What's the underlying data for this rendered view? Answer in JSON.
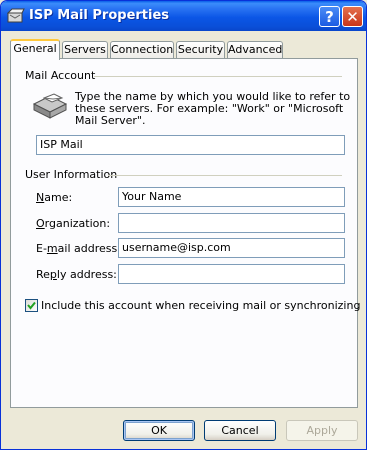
{
  "window": {
    "title": "ISP Mail Properties"
  },
  "titlebar_buttons": {
    "help": "?",
    "close": "✕"
  },
  "tabs": [
    {
      "label": "General",
      "active": true
    },
    {
      "label": "Servers"
    },
    {
      "label": "Connection"
    },
    {
      "label": "Security"
    },
    {
      "label": "Advanced"
    }
  ],
  "mail_account": {
    "group_label": "Mail Account",
    "description": "Type the name by which you would like to refer to these servers.  For example: \"Work\" or \"Microsoft Mail Server\".",
    "account_name": "ISP Mail"
  },
  "user_info": {
    "group_label": "User Information",
    "fields": {
      "name": {
        "label_pre": "",
        "label_accel": "N",
        "label_post": "ame:",
        "value": "Your Name"
      },
      "organization": {
        "label_pre": "",
        "label_accel": "O",
        "label_post": "rganization:",
        "value": ""
      },
      "email": {
        "label_pre": "E-",
        "label_accel": "m",
        "label_post": "ail address:",
        "value": "username@isp.com"
      },
      "reply": {
        "label_pre": "Re",
        "label_accel": "p",
        "label_post": "ly address:",
        "value": ""
      }
    }
  },
  "include_checkbox": {
    "label": "Include this account when receiving mail or synchronizing",
    "checked": true
  },
  "buttons": {
    "ok": "OK",
    "cancel": "Cancel",
    "apply": "Apply"
  },
  "colors": {
    "titlebar": "#0A53E0",
    "dialog_bg": "#ECE9D8",
    "panel_bg": "#FCFCFE",
    "tab_highlight": "#FFC83C"
  }
}
